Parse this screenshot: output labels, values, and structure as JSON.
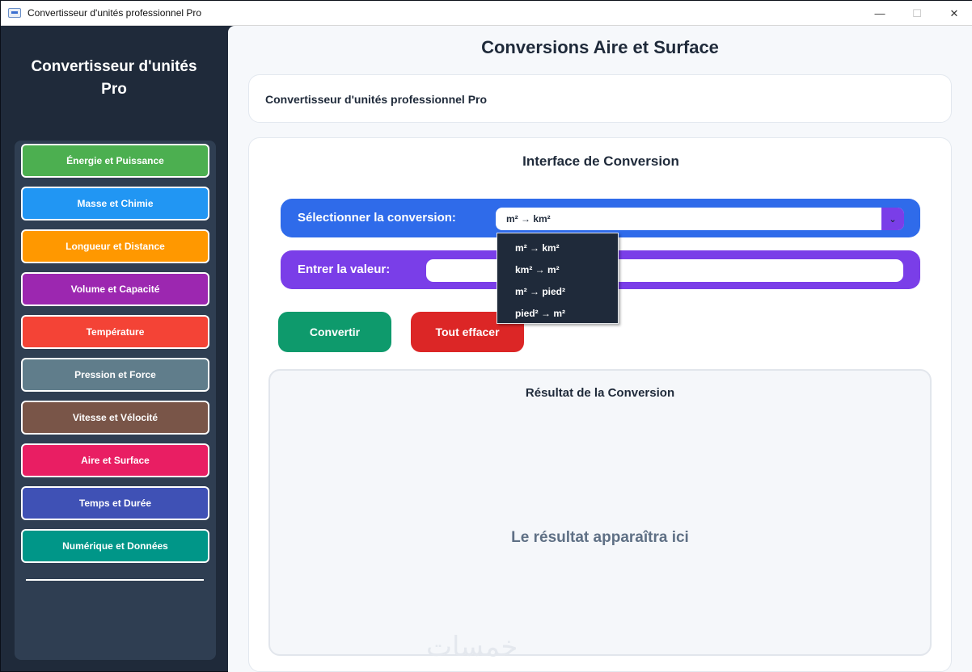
{
  "window": {
    "title": "Convertisseur d'unités professionnel Pro",
    "minimize": "—",
    "maximize": "☐",
    "close": "✕"
  },
  "sidebar": {
    "title": "Convertisseur d'unités Pro",
    "items": [
      {
        "label": "Énergie et Puissance",
        "color": "#4caf50"
      },
      {
        "label": "Masse et Chimie",
        "color": "#2196f3"
      },
      {
        "label": "Longueur et Distance",
        "color": "#ff9800"
      },
      {
        "label": "Volume et Capacité",
        "color": "#9c27b0"
      },
      {
        "label": "Température",
        "color": "#f44336"
      },
      {
        "label": "Pression et Force",
        "color": "#607d8b"
      },
      {
        "label": "Vitesse et Vélocité",
        "color": "#795548"
      },
      {
        "label": "Aire et Surface",
        "color": "#e91e63"
      },
      {
        "label": "Temps et Durée",
        "color": "#3f51b5"
      },
      {
        "label": "Numérique et Données",
        "color": "#009688"
      }
    ]
  },
  "main": {
    "title": "Conversions Aire et Surface",
    "info_text": "Convertisseur d'unités professionnel Pro",
    "interface_title": "Interface de Conversion",
    "select_label": "Sélectionner la conversion:",
    "selected_conversion": "m² → km²",
    "value_label": "Entrer la valeur:",
    "value_input": "",
    "convert_button": "Convertir",
    "clear_button": "Tout effacer",
    "result_title": "Résultat de la Conversion",
    "result_placeholder": "Le résultat apparaîtra ici"
  },
  "dropdown": {
    "options": [
      "m² → km²",
      "km² → m²",
      "m² → pied²",
      "pied² → m²"
    ]
  },
  "watermark": "خمسات",
  "icons": {
    "dropdown_arrow": "chevron-down-icon",
    "app": "app-icon"
  }
}
